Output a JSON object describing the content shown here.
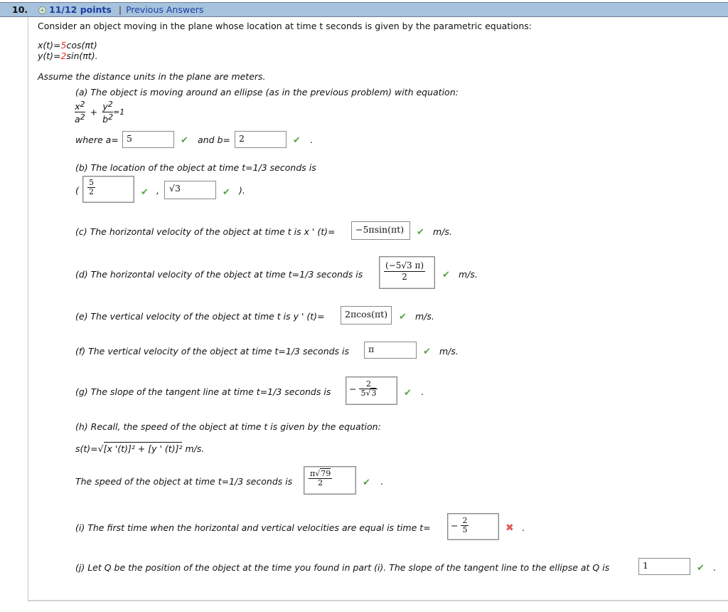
{
  "header": {
    "number": "10.",
    "plus_icon": "plus-circle-icon",
    "score": "11/12 points",
    "separator": "|",
    "previous_answers": "Previous Answers",
    "color": "#a7c2dd"
  },
  "intro": "Consider an object moving in the plane whose location at time t seconds is given by the parametric equations:",
  "equations": {
    "x_prefix": "x(t)=",
    "x_coef": "5",
    "x_rest": "cos(πt)",
    "y_prefix": "y(t)=",
    "y_coef": "2",
    "y_rest": "sin(πt).",
    "highlight_color": "#e0312c"
  },
  "assume": "Assume the distance units in the plane are meters.",
  "parts": {
    "a": {
      "text": "(a) The object is moving around an ellipse (as in the previous problem) with equation:",
      "eq_x": "x",
      "eq_a": "a",
      "eq_y": "y",
      "eq_b": "b",
      "eq_sq": "2",
      "eq_plus": "+",
      "eq_eq": "=1",
      "where_a": "where a=",
      "a_value": "5",
      "and_b": "and b=",
      "b_value": "2",
      "end": ".",
      "status_a": "correct",
      "status_b": "correct"
    },
    "b": {
      "text": "(b) The location of the object at time t=1/3 seconds is",
      "open": "(",
      "comma": ",",
      "close": ").",
      "x_num": "5",
      "x_den": "2",
      "y_value": "√3",
      "status_x": "correct",
      "status_y": "correct"
    },
    "c": {
      "text": "(c) The horizontal velocity of the object at time t is x ' (t)=",
      "value": "−5πsin(πt)",
      "unit": "m/s.",
      "status": "correct"
    },
    "d": {
      "text": "(d) The horizontal velocity of the object at time t=1/3 seconds is",
      "num": "(−5√3 π)",
      "den": "2",
      "unit": "m/s.",
      "status": "correct"
    },
    "e": {
      "text": "(e) The vertical velocity of the object at time t is y ' (t)=",
      "value": "2πcos(πt)",
      "unit": "m/s.",
      "status": "correct"
    },
    "f": {
      "text": "(f) The vertical velocity of the object at time t=1/3 seconds is",
      "value": "π",
      "unit": "m/s.",
      "status": "correct"
    },
    "g": {
      "text": "(g) The slope of the tangent line at time t=1/3 seconds is",
      "sign": "−",
      "num": "2",
      "den_a": "5",
      "den_b": "3",
      "end": ".",
      "status": "correct"
    },
    "h": {
      "text": "(h) Recall, the speed of the object at time t is given by the equation:",
      "formula_left": "s(t)=√",
      "formula_inside": "[x '(t)]² + [y ' (t)]²",
      "formula_unit": "m/s.",
      "speed_text": "The speed of the object at time t=1/3 seconds is",
      "num_a": "π",
      "num_b": "79",
      "den": "2",
      "end": ".",
      "status": "correct"
    },
    "i": {
      "text": "(i) The first time when the horizontal and vertical velocities are equal is time t=",
      "sign": "−",
      "num": "2",
      "den": "5",
      "end": ".",
      "status": "incorrect"
    },
    "j": {
      "text": "(j) Let Q be the position of the object at the time you found in part (i). The slope of the tangent line to the ellipse at Q is",
      "value": "1",
      "end": ".",
      "status": "correct"
    }
  },
  "icons": {
    "check": "✔",
    "cross": "✖",
    "check_color": "#5aa04a",
    "cross_color": "#e05a5a"
  }
}
